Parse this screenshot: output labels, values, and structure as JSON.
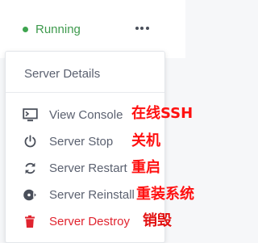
{
  "server_card": {
    "status_label": "Running",
    "status_color": "#3ea44f"
  },
  "menu": {
    "header": "Server Details",
    "items": [
      {
        "label": "View Console",
        "icon": "monitor-icon"
      },
      {
        "label": "Server Stop",
        "icon": "power-icon"
      },
      {
        "label": "Server Restart",
        "icon": "restart-icon"
      },
      {
        "label": "Server Reinstall",
        "icon": "disc-icon"
      },
      {
        "label": "Server Destroy",
        "icon": "trash-icon",
        "color": "#e0242f"
      }
    ]
  },
  "annotations": {
    "console": "在线SSH",
    "stop": "关机",
    "restart": "重启",
    "reinstall": "重装系统",
    "destroy": "销毁"
  }
}
